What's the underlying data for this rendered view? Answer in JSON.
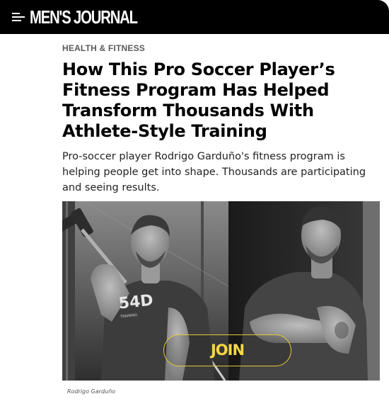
{
  "header": {
    "logo_text": "MEN'S JOURNAL",
    "menu_icon": "hamburger-menu-icon"
  },
  "article": {
    "category": "HEALTH & FITNESS",
    "headline": "How This Pro Soccer Player’s Fitness Program Has Helped Transform Thousands With Athlete-Style Training",
    "dek": "Pro-soccer player Rodrigo Garduño's fitness program is helping people get into shape. Thousands are participating and seeing results.",
    "image": {
      "shirt_text": "54D",
      "shirt_subtext": "TRAINING",
      "cta_label": "JOIN",
      "caption": "Rodrigo Garduño"
    }
  },
  "colors": {
    "header_bg": "#000000",
    "cta_accent": "#e4c63a",
    "category": "#5a5a5a"
  }
}
